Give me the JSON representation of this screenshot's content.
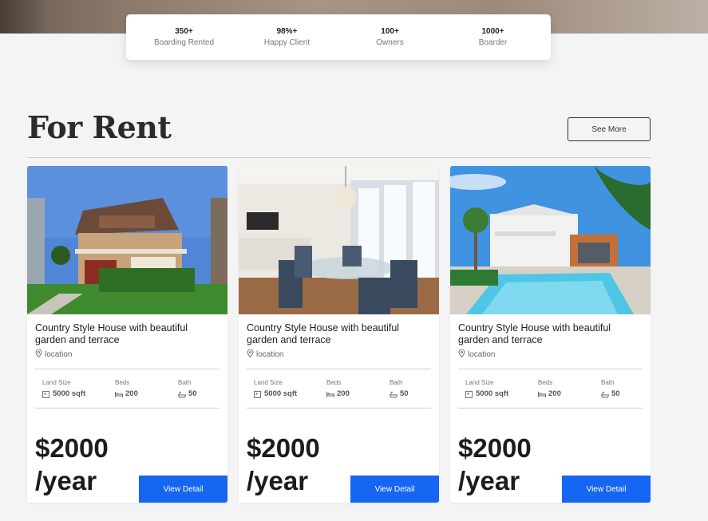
{
  "stats": [
    {
      "value": "350+",
      "label": "Boarding Rented"
    },
    {
      "value": "98%+",
      "label": "Happy Client"
    },
    {
      "value": "100+",
      "label": "Owners"
    },
    {
      "value": "1000+",
      "label": "Boarder"
    }
  ],
  "section": {
    "title": "For Rent",
    "see_more_label": "See More"
  },
  "spec_labels": {
    "land": "Land Size",
    "beds": "Beds",
    "bath": "Bath"
  },
  "colors": {
    "accent": "#1566f2",
    "background": "#f4f4f4"
  },
  "listings": [
    {
      "title": "Country Style House with beautiful garden and terrace",
      "location": "location",
      "land_size": "5000 sqft",
      "beds": "200",
      "bath": "50",
      "price": "$2000",
      "period": "/year",
      "button_label": "View Detail",
      "image": "house-exterior"
    },
    {
      "title": "Country Style House with beautiful garden and terrace",
      "location": "location",
      "land_size": "5000 sqft",
      "beds": "200",
      "bath": "50",
      "price": "$2000",
      "period": "/year",
      "button_label": "View Detail",
      "image": "dining-room-interior"
    },
    {
      "title": "Country Style House with beautiful garden and terrace",
      "location": "location",
      "land_size": "5000 sqft",
      "beds": "200",
      "bath": "50",
      "price": "$2000",
      "period": "/year",
      "button_label": "View Detail",
      "image": "house-with-pool"
    }
  ],
  "icons": {
    "location": "map-pin-icon",
    "land_size": "area-icon",
    "beds": "bed-icon",
    "bath": "bathtub-icon"
  }
}
